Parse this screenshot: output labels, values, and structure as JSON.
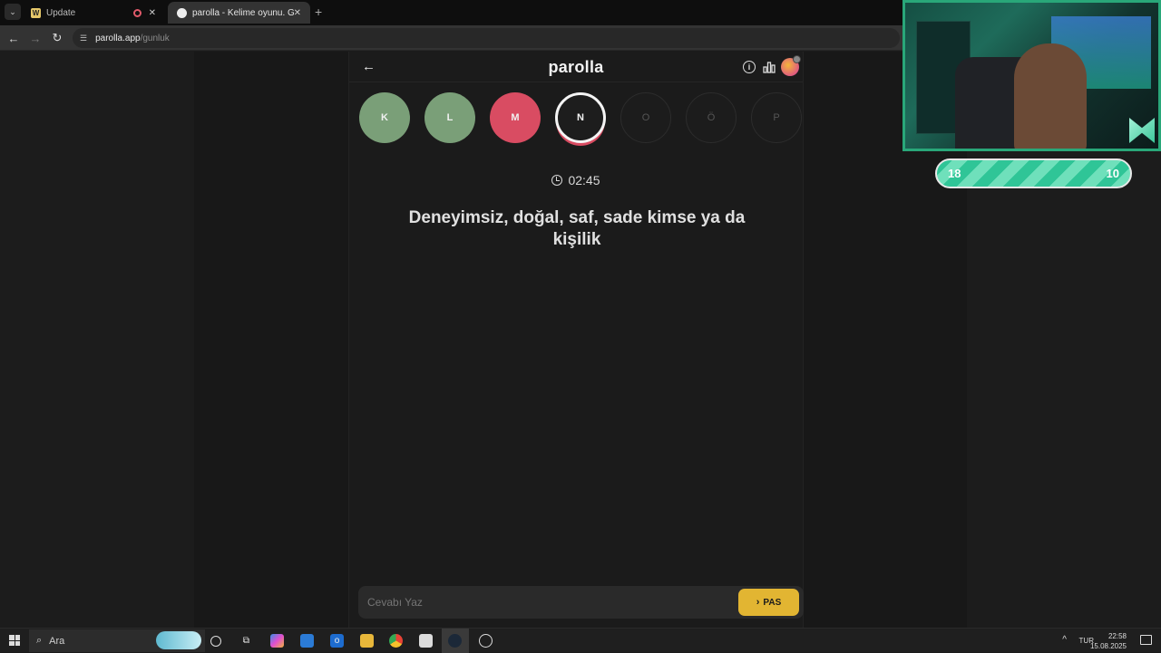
{
  "browser": {
    "tabs": [
      {
        "label": "Update",
        "favicon": "wiki-icon",
        "recording": true
      },
      {
        "label": "parolla - Kelime oyunu. Günlük",
        "favicon": "parolla-icon",
        "active": true
      }
    ],
    "new_tab_glyph": "+",
    "close_glyph": "✕",
    "url_domain": "parolla.app",
    "url_path": "/gunluk"
  },
  "game": {
    "logo": "parolla",
    "letters": [
      {
        "char": "K",
        "state": "correct"
      },
      {
        "char": "L",
        "state": "correct"
      },
      {
        "char": "M",
        "state": "wrong"
      },
      {
        "char": "N",
        "state": "current"
      },
      {
        "char": "O",
        "state": "pending"
      },
      {
        "char": "Ö",
        "state": "pending"
      },
      {
        "char": "P",
        "state": "pending"
      }
    ],
    "timer": "02:45",
    "question": "Deneyimsiz, doğal, saf, sade kimse ya da kişilik",
    "answer_placeholder": "Cevabı Yaz",
    "pass_label": "PAS",
    "colors": {
      "correct": "#7a9f78",
      "wrong": "#d94c62",
      "accent": "#e2b532"
    }
  },
  "overlay": {
    "score_left": "18",
    "score_right": "10",
    "cam_border_color": "#29a779"
  },
  "taskbar": {
    "search_label": "Ara",
    "language": "TUR",
    "time": "22:58",
    "date": "15.08.2025"
  }
}
